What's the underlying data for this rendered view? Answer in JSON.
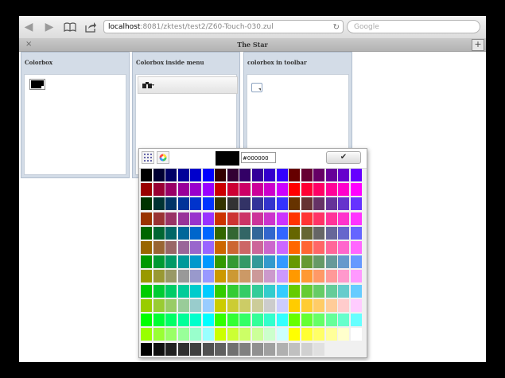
{
  "browser": {
    "url_host": "localhost",
    "url_path": ":8081/zktest/test2/Z60-Touch-030.zul",
    "search_placeholder": "Google"
  },
  "tab": {
    "close": "×",
    "title": "The Star",
    "add": "+"
  },
  "panels": [
    {
      "title": "Colorbox"
    },
    {
      "title": "Colorbox inside menu"
    },
    {
      "title": "colorbox in toolbar"
    }
  ],
  "colorbox": {
    "current_hex": "#000000",
    "current_color": "#000000"
  },
  "icons": {
    "back": "back-icon",
    "forward": "forward-icon",
    "bookmarks": "book-icon",
    "share": "share-icon",
    "reload": "reload-icon",
    "palette": "palette-grid-icon",
    "picker": "color-wheel-icon",
    "ok": "check-icon",
    "menu": "binoculars-icon"
  }
}
